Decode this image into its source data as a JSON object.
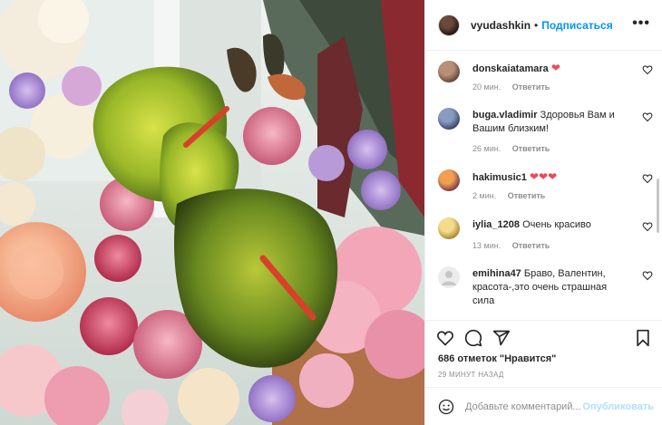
{
  "colors": {
    "accent_blue": "#0095f6",
    "post_disabled": "#b2dffc",
    "heart_red": "#ed4956",
    "meta_gray": "#8e8e8e",
    "text_dark": "#262626"
  },
  "post": {
    "image_icon": "flower-bouquet-photo"
  },
  "header": {
    "username": "vyudashkin",
    "separator": "•",
    "follow_label": "Подписаться",
    "more_label": "•••"
  },
  "comments": [
    {
      "username": "donskaiatamara",
      "text": "",
      "emoji": "❤",
      "time": "20 мин.",
      "reply": "Ответить",
      "avatar_color": "#7a5a4a"
    },
    {
      "username": "buga.vladimir",
      "text": "Здоровья Вам и Вашим близким!",
      "emoji": "",
      "time": "26 мин.",
      "reply": "Ответить",
      "avatar_color": "#3b4a6b"
    },
    {
      "username": "hakimusic1",
      "text": "",
      "emoji": "❤❤❤",
      "time": "2 мин.",
      "reply": "Ответить",
      "avatar_color": "#c46a2a"
    },
    {
      "username": "iylia_1208",
      "text": "Очень красиво",
      "emoji": "",
      "time": "13 мин.",
      "reply": "Ответить",
      "avatar_color": "#d4b04a"
    },
    {
      "username": "emihina47",
      "text": "Браво, Валентин, красота-,это очень страшная сила",
      "emoji": "",
      "time": "",
      "reply": "",
      "avatar_color": "#dcdcdc"
    }
  ],
  "actions": {
    "likes": "686 отметок \"Нравится\"",
    "time_ago": "29 МИНУТ НАЗАД"
  },
  "add_comment": {
    "placeholder": "Добавьте комментарий...",
    "post_label": "Опубликовать"
  }
}
